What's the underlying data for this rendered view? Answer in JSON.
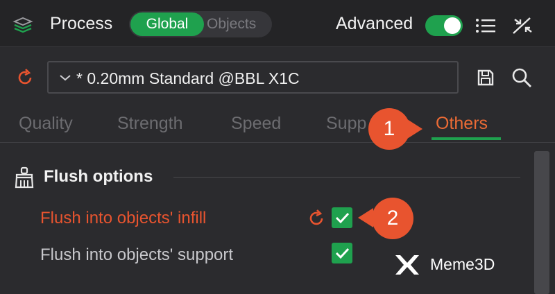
{
  "header": {
    "title": "Process",
    "segment": {
      "global_label": "Global",
      "objects_label": "Objects",
      "selected": "Global"
    },
    "advanced_label": "Advanced",
    "advanced_enabled": true
  },
  "preset": {
    "value": "* 0.20mm Standard @BBL X1C"
  },
  "tabs": [
    {
      "label": "Quality",
      "active": false
    },
    {
      "label": "Strength",
      "active": false
    },
    {
      "label": "Speed",
      "active": false
    },
    {
      "label": "Supp",
      "active": false
    },
    {
      "label": "Others",
      "active": true
    }
  ],
  "callouts": {
    "first": "1",
    "second": "2"
  },
  "section": {
    "title": "Flush options",
    "options": [
      {
        "label": "Flush into objects' infill",
        "checked": true,
        "modified": true
      },
      {
        "label": "Flush into objects' support",
        "checked": true,
        "modified": false
      }
    ]
  },
  "brand": {
    "name": "Meme3D"
  },
  "colors": {
    "accent_green": "#1fa14e",
    "modified_orange": "#e8542f",
    "background": "#2b2b2e"
  },
  "icons": [
    "layers-icon",
    "list-icon",
    "collapse-icon",
    "reset-icon",
    "chevron-down-icon",
    "save-icon",
    "search-icon",
    "broom-icon",
    "check-icon",
    "meme3d-logo-icon"
  ]
}
